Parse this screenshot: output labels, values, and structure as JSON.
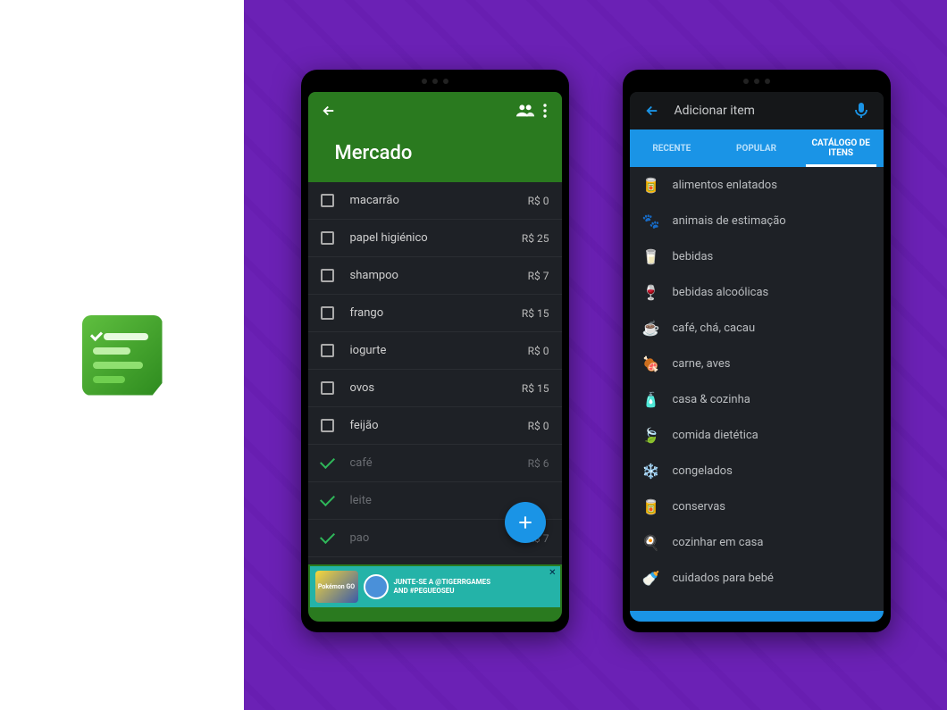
{
  "phone1": {
    "title": "Mercado",
    "items": [
      {
        "name": "macarrão",
        "price": "R$ 0",
        "done": false
      },
      {
        "name": "papel higiénico",
        "price": "R$ 25",
        "done": false
      },
      {
        "name": "shampoo",
        "price": "R$ 7",
        "done": false
      },
      {
        "name": "frango",
        "price": "R$ 15",
        "done": false
      },
      {
        "name": "iogurte",
        "price": "R$ 0",
        "done": false
      },
      {
        "name": "ovos",
        "price": "R$ 15",
        "done": false
      },
      {
        "name": "feijão",
        "price": "R$ 0",
        "done": false
      },
      {
        "name": "café",
        "price": "R$ 6",
        "done": true
      },
      {
        "name": "leite",
        "price": "",
        "done": true
      },
      {
        "name": "pao",
        "price": "R$ 7",
        "done": true
      }
    ],
    "ad": {
      "logo": "Pokémon GO",
      "line1": "JUNTE-SE A @TIGERRGAMES",
      "line2": "AND #PEGUEOSEU"
    }
  },
  "phone2": {
    "search_placeholder": "Adicionar item",
    "tabs": [
      "RECENTE",
      "POPULAR",
      "CATÁLOGO DE ITENS"
    ],
    "active_tab": 2,
    "categories": [
      {
        "icon": "🥫",
        "label": "alimentos enlatados"
      },
      {
        "icon": "🐾",
        "label": "animais de estimação"
      },
      {
        "icon": "🥛",
        "label": "bebidas"
      },
      {
        "icon": "🍷",
        "label": "bebidas alcoólicas"
      },
      {
        "icon": "☕",
        "label": "café, chá, cacau"
      },
      {
        "icon": "🍖",
        "label": "carne, aves"
      },
      {
        "icon": "🧴",
        "label": "casa & cozinha"
      },
      {
        "icon": "🍃",
        "label": "comida dietética"
      },
      {
        "icon": "❄️",
        "label": "congelados"
      },
      {
        "icon": "🥫",
        "label": "conservas"
      },
      {
        "icon": "🍳",
        "label": "cozinhar em casa"
      },
      {
        "icon": "🍼",
        "label": "cuidados para bebé"
      }
    ]
  }
}
